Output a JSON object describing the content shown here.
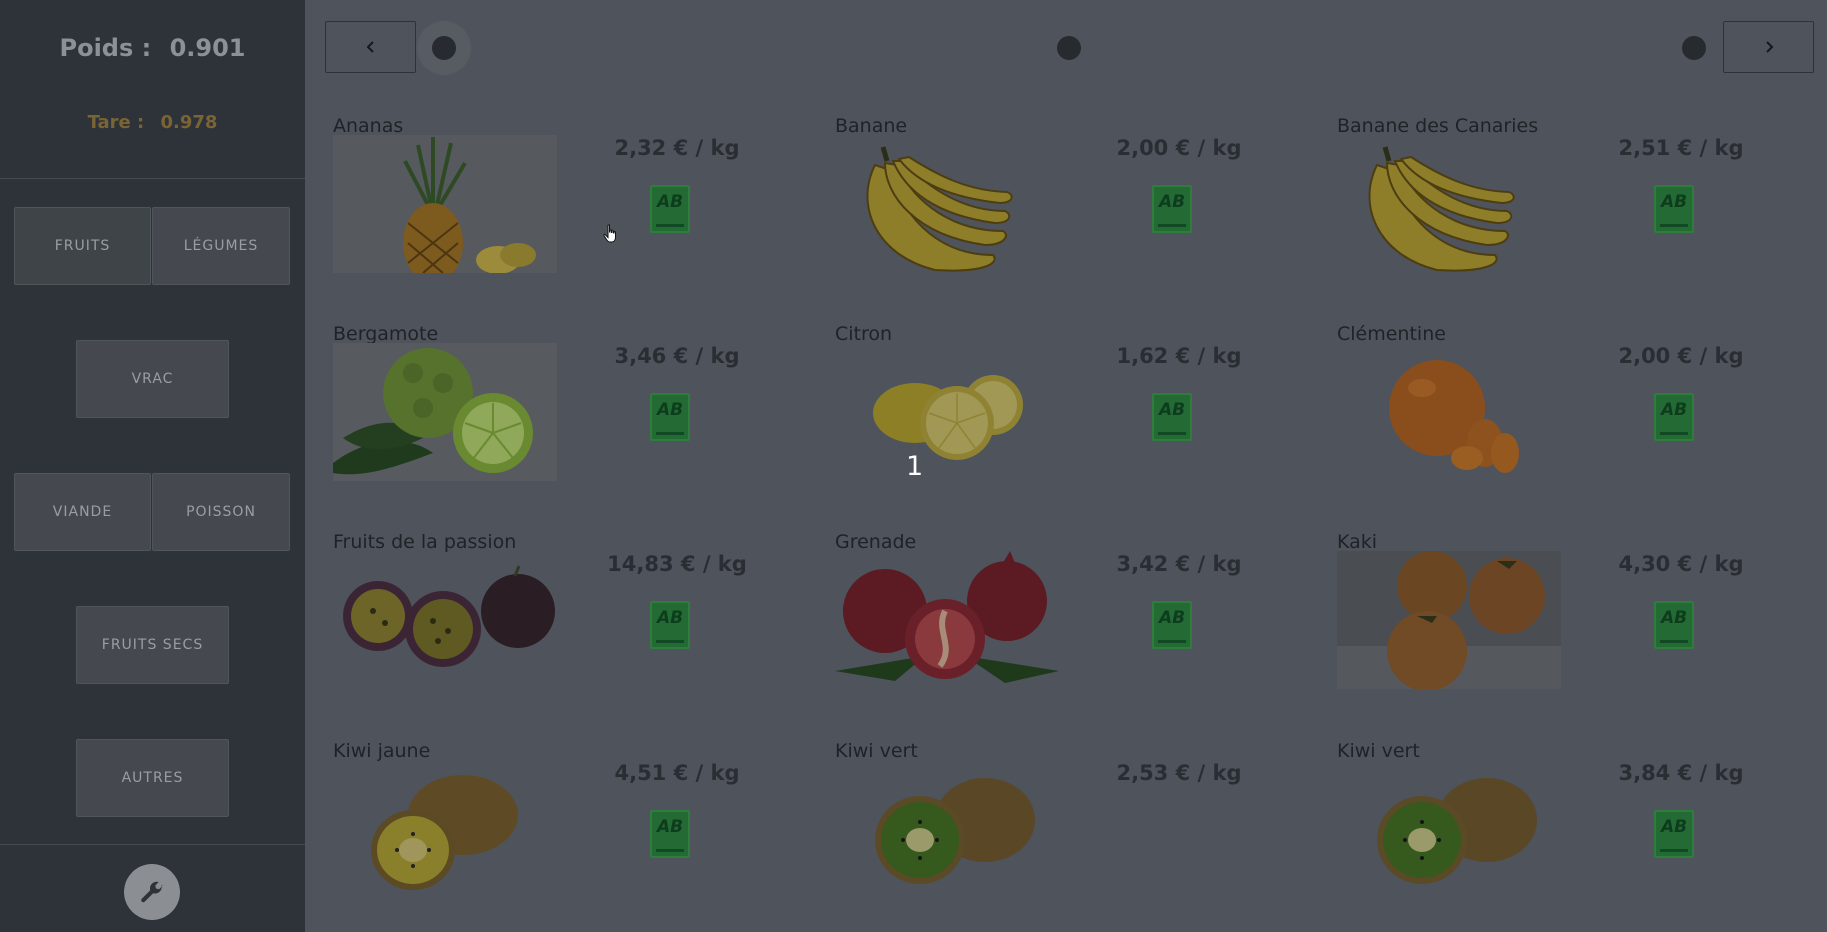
{
  "sidebar": {
    "poids_label": "Poids :",
    "poids_value": "0.901",
    "tare_label": "Tare :",
    "tare_value": "0.978",
    "categories": {
      "fruits": "FRUITS",
      "legumes": "LÉGUMES",
      "vrac": "VRAC",
      "viande": "VIANDE",
      "poisson": "POISSON",
      "fruits_secs": "FRUITS SECS",
      "autres": "AUTRES"
    },
    "active_category": "FRUITS",
    "settings_icon": "wrench-icon"
  },
  "pagination": {
    "prev_icon": "chevron-left-icon",
    "next_icon": "chevron-right-icon",
    "pages": 3,
    "current_page": 1
  },
  "products": [
    {
      "name": "Ananas",
      "price": "2,32 € / kg",
      "organic": true,
      "image": "pineapple"
    },
    {
      "name": "Banane",
      "price": "2,00 € / kg",
      "organic": true,
      "image": "banana"
    },
    {
      "name": "Banane des Canaries",
      "price": "2,51 € / kg",
      "organic": true,
      "image": "banana"
    },
    {
      "name": "Bergamote",
      "price": "3,46 € / kg",
      "organic": true,
      "image": "bergamot"
    },
    {
      "name": "Citron",
      "price": "1,62 € / kg",
      "organic": true,
      "image": "lemon"
    },
    {
      "name": "Clémentine",
      "price": "2,00 € / kg",
      "organic": true,
      "image": "clementine"
    },
    {
      "name": "Fruits de la passion",
      "price": "14,83 € / kg",
      "organic": true,
      "image": "passion-fruit"
    },
    {
      "name": "Grenade",
      "price": "3,42 € / kg",
      "organic": true,
      "image": "pomegranate"
    },
    {
      "name": "Kaki",
      "price": "4,30 € / kg",
      "organic": true,
      "image": "kaki"
    },
    {
      "name": "Kiwi jaune",
      "price": "4,51 € / kg",
      "organic": true,
      "image": "kiwi-yellow"
    },
    {
      "name": "Kiwi vert",
      "price": "2,53 € / kg",
      "organic": false,
      "image": "kiwi-green"
    },
    {
      "name": "Kiwi vert",
      "price": "3,84 € / kg",
      "organic": true,
      "image": "kiwi-green"
    }
  ],
  "organic_badge_text": "AB",
  "overlay_number": "1",
  "colors": {
    "sidebar_bg": "#2e3339",
    "main_bg": "#4e535c",
    "organic_green": "#246a35",
    "tare_text": "#7b6433"
  }
}
